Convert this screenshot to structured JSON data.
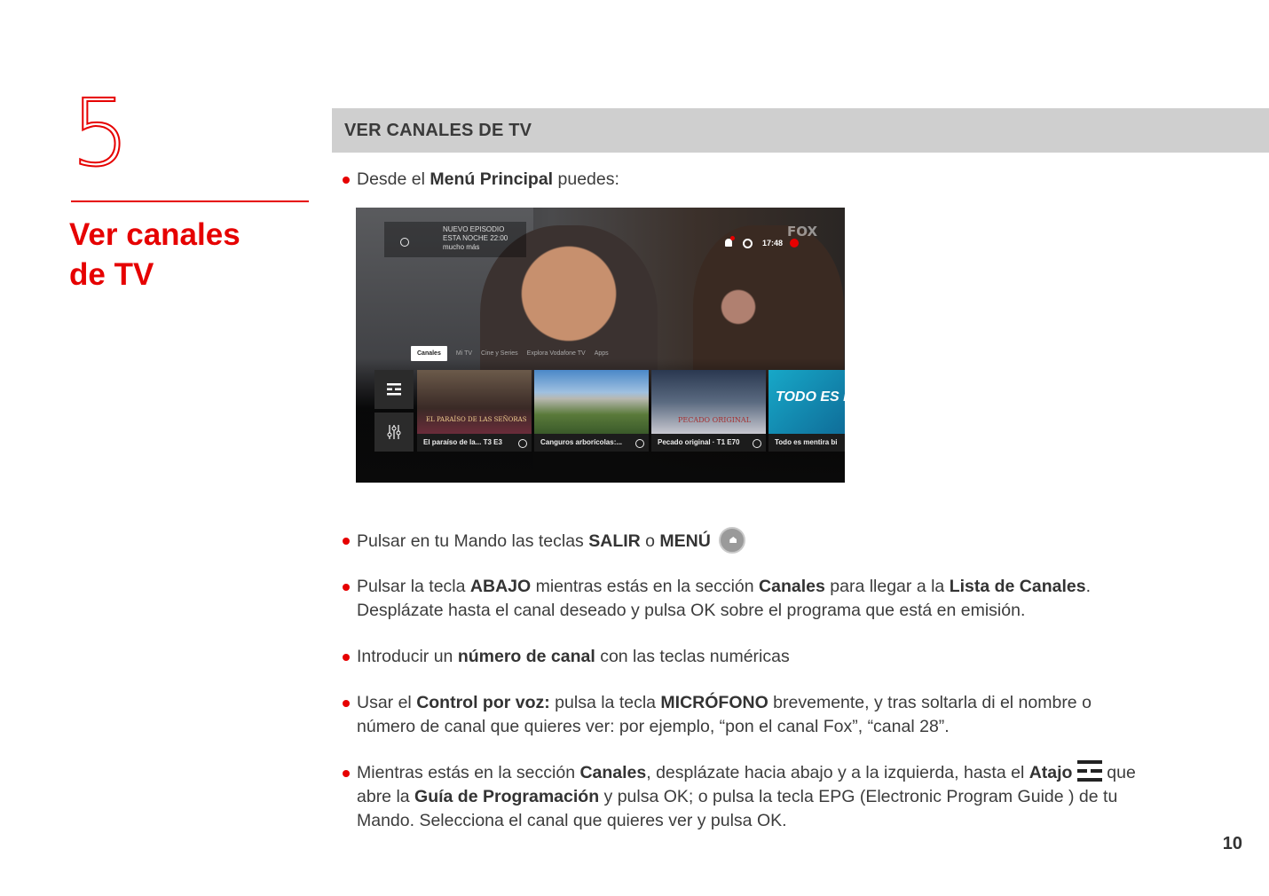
{
  "chapter": {
    "number": "5",
    "title_line1": "Ver canales",
    "title_line2": "de TV"
  },
  "section": {
    "title": "VER CANALES DE TV"
  },
  "intro": {
    "pre": "Desde el ",
    "bold": "Menú Principal",
    "post": " puedes:"
  },
  "tv_screen": {
    "promo_line1": "NUEVO EPISODIO",
    "promo_line2": "ESTA NOCHE 22:00",
    "promo_more": "mucho más",
    "time": "17:48",
    "channel_logo": "FOX",
    "tabs": [
      "Canales",
      "Mi TV",
      "Cine y Series",
      "Explora Vodafone TV",
      "Apps"
    ],
    "cards": [
      {
        "caption": "El paraíso de la... T3 E3",
        "overlay": "EL PARAÍSO DE LAS SEÑORAS"
      },
      {
        "caption": "Canguros arborícolas:...",
        "overlay": ""
      },
      {
        "caption": "Pecado original · T1 E70",
        "overlay": "PECADO ORIGINAL"
      },
      {
        "caption": "Todo es mentira bi",
        "overlay": "TODO ES MENTI"
      }
    ]
  },
  "bullets": [
    {
      "parts": [
        "Pulsar en tu Mando las teclas ",
        "SALIR",
        " o ",
        "MENÚ"
      ]
    },
    {
      "parts": [
        "Pulsar la tecla ",
        "ABAJO",
        " mientras estás en la sección ",
        "Canales",
        " para llegar a la ",
        "Lista de Canales",
        "."
      ],
      "line2": "Desplázate hasta el canal deseado y pulsa OK sobre el programa que está en emisión."
    },
    {
      "parts": [
        "Introducir un ",
        "número de canal",
        " con las teclas numéricas"
      ]
    },
    {
      "parts": [
        "Usar el ",
        "Control por voz:",
        " pulsa la tecla ",
        "MICRÓFONO",
        " brevemente, y tras soltarla di el nombre o"
      ],
      "line2": "número de canal que quieres ver: por ejemplo, “pon el canal Fox”, “canal 28”."
    },
    {
      "parts": [
        "Mientras estás en la sección ",
        "Canales",
        ", desplázate hacia abajo y a la izquierda, hasta el ",
        "Atajo",
        " que"
      ],
      "line2_parts": [
        "abre la ",
        "Guía de Programación",
        " y pulsa OK; o pulsa la tecla EPG (Electronic Program Guide )  de tu"
      ],
      "line3": "Mando. Selecciona el canal que quieres ver y pulsa OK."
    }
  ],
  "page_number": "10",
  "colors": {
    "accent": "#e60000",
    "section_bar": "#cfcfcf"
  }
}
